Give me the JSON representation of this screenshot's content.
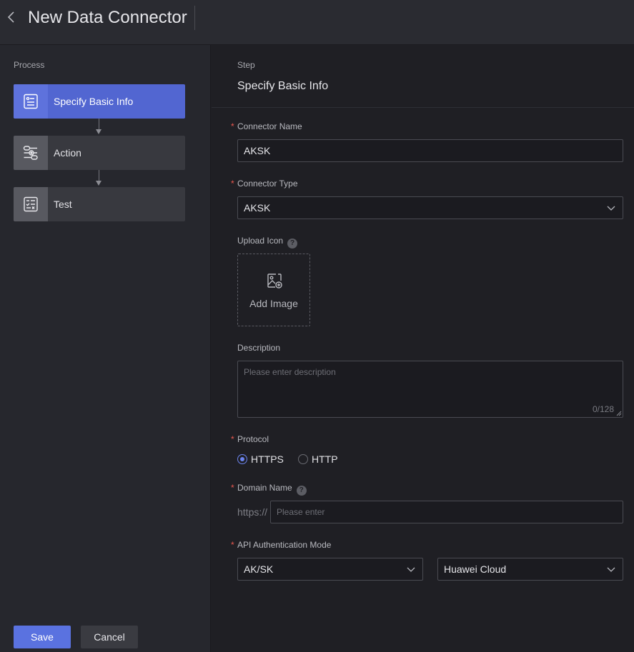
{
  "header": {
    "title": "New Data Connector"
  },
  "process": {
    "label": "Process",
    "steps": [
      {
        "label": "Specify Basic Info",
        "icon": "form-icon",
        "active": true
      },
      {
        "label": "Action",
        "icon": "sliders-icon",
        "active": false
      },
      {
        "label": "Test",
        "icon": "checklist-icon",
        "active": false
      }
    ]
  },
  "footer": {
    "save_label": "Save",
    "cancel_label": "Cancel"
  },
  "form": {
    "step_caption": "Step",
    "step_title": "Specify Basic Info",
    "connector_name": {
      "label": "Connector Name",
      "value": "AKSK"
    },
    "connector_type": {
      "label": "Connector Type",
      "value": "AKSK"
    },
    "upload_icon": {
      "label": "Upload Icon",
      "button_text": "Add Image"
    },
    "description": {
      "label": "Description",
      "placeholder": "Please enter description",
      "counter": "0/128"
    },
    "protocol": {
      "label": "Protocol",
      "options": [
        "HTTPS",
        "HTTP"
      ],
      "selected": "HTTPS"
    },
    "domain_name": {
      "label": "Domain Name",
      "prefix": "https://",
      "placeholder": "Please enter"
    },
    "auth_mode": {
      "label": "API Authentication Mode",
      "mode_value": "AK/SK",
      "provider_value": "Huawei Cloud"
    }
  },
  "colors": {
    "accent": "#5a72e0",
    "required": "#e8584f",
    "background": "#1f1f24"
  }
}
